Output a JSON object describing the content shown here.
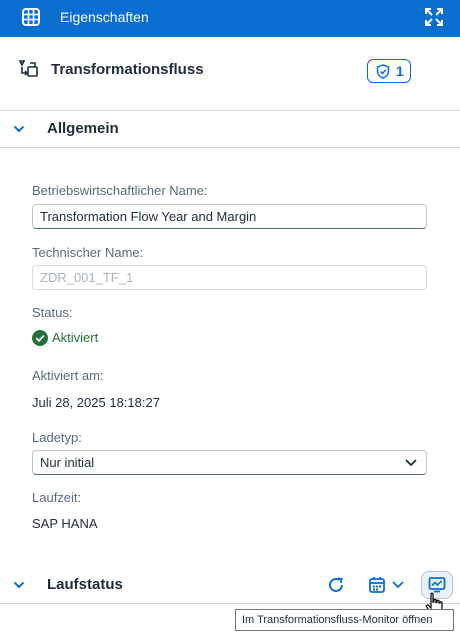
{
  "header": {
    "title": "Eigenschaften",
    "grid_icon": "grid-icon",
    "expand_icon": "expand-icon"
  },
  "object": {
    "title": "Transformationsfluss",
    "icon": "transformation-flow-icon",
    "badge_count": "1"
  },
  "sections": {
    "general": {
      "label": "Allgemein"
    },
    "run_status": {
      "label": "Laufstatus"
    }
  },
  "fields": {
    "business_name": {
      "label": "Betriebswirtschaftlicher Name:",
      "value": "Transformation Flow Year and Margin"
    },
    "technical_name": {
      "label": "Technischer Name:",
      "value": "ZDR_001_TF_1"
    },
    "status": {
      "label": "Status:",
      "value": "Aktiviert"
    },
    "activated_on": {
      "label": "Aktiviert am:",
      "value": "Juli 28, 2025 18:18:27"
    },
    "load_type": {
      "label": "Ladetyp:",
      "value": "Nur initial"
    },
    "runtime": {
      "label": "Laufzeit:",
      "value": "SAP HANA"
    }
  },
  "tooltip": "Im Transformationsfluss-Monitor öffnen",
  "colors": {
    "brand": "#0a6ed1",
    "success": "#256f3a",
    "text": "#1d2d3e",
    "label": "#556b82"
  }
}
